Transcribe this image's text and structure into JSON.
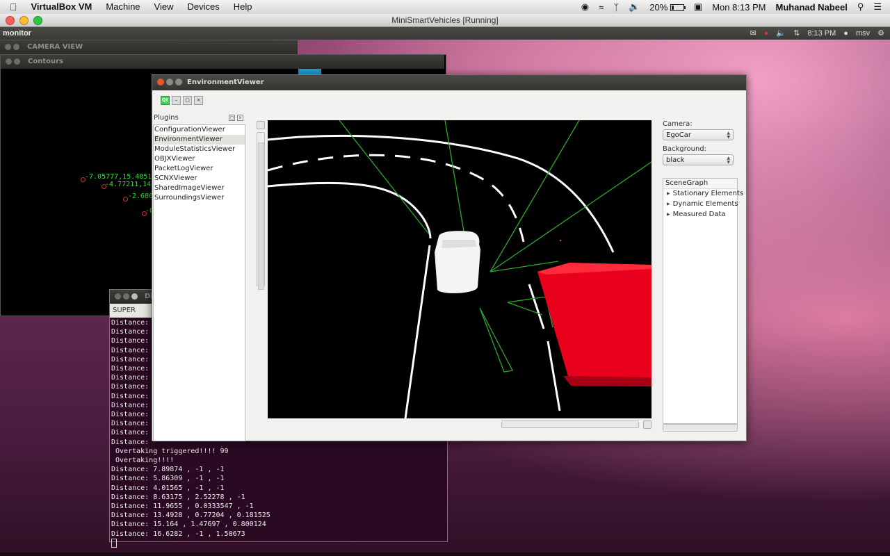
{
  "mac_menubar": {
    "app_name": "VirtualBox VM",
    "menus": [
      "Machine",
      "View",
      "Devices",
      "Help"
    ],
    "battery": "20%",
    "clock": "Mon 8:13 PM",
    "user": "Muhanad Nabeel"
  },
  "vbox": {
    "title": "MiniSmartVehicles [Running]"
  },
  "ubuntu_panel": {
    "app": "monitor",
    "time": "8:13 PM",
    "user": "msv"
  },
  "windows": {
    "camera_title": "CAMERA VIEW",
    "contours_title": "Contours",
    "contour_labels": [
      "-7.05777,15.4851",
      "-4.77211,14",
      "-2.686",
      "-0"
    ],
    "terminal_title": "Di",
    "terminal_tab": "SUPER",
    "terminal_lines": [
      "Distance:",
      "Distance:",
      "Distance:",
      "Distance:",
      "Distance:",
      "Distance:",
      "Distance:",
      "Distance:",
      "Distance:",
      "Distance:",
      "Distance:",
      "Distance:",
      "Distance:",
      "Distance:",
      " Overtaking triggered!!!! 99",
      " Overtaking!!!!",
      "Distance: 7.89874 , -1 , -1",
      "Distance: 5.86309 , -1 , -1",
      "Distance: 4.01565 , -1 , -1",
      "Distance: 8.63175 , 2.52278 , -1",
      "Distance: 11.9655 , 0.0333547 , -1",
      "Distance: 13.4928 , 0.77204 , 0.181525",
      "Distance: 15.164 , 1.47697 , 0.800124",
      "Distance: 16.6282 , -1 , 1.50673"
    ]
  },
  "env_viewer": {
    "title": "EnvironmentViewer",
    "plugins_header": "Plugins",
    "plugins": [
      "ConfigurationViewer",
      "EnvironmentViewer",
      "ModuleStatisticsViewer",
      "OBJXViewer",
      "PacketLogViewer",
      "SCNXViewer",
      "SharedImageViewer",
      "SurroundingsViewer"
    ],
    "selected_plugin_index": 1,
    "camera_label": "Camera:",
    "camera_value": "EgoCar",
    "background_label": "Background:",
    "background_value": "black",
    "scenegraph_header": "SceneGraph",
    "scenegraph_items": [
      "Stationary Elements",
      "Dynamic Elements",
      "Measured Data"
    ],
    "colors": {
      "obstacle": "#e8001c",
      "sensor_rays": "#2ea82e",
      "lane": "#ffffff"
    }
  }
}
